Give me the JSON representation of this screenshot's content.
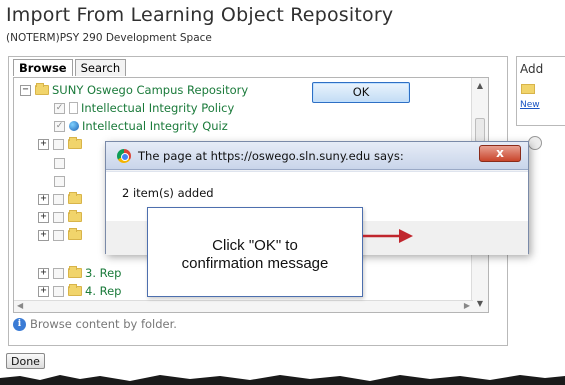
{
  "page": {
    "title": "Import From Learning Object Repository",
    "subtitle": "(NOTERM)PSY 290 Development Space"
  },
  "tabs": [
    {
      "label": "Browse",
      "active": true
    },
    {
      "label": "Search",
      "active": false
    }
  ],
  "tree": {
    "root": {
      "label": "SUNY Oswego Campus Repository",
      "expander": "−"
    },
    "items": [
      {
        "label": "Intellectual Integrity Policy",
        "icon": "document-icon",
        "checked": true
      },
      {
        "label": "Intellectual Integrity Quiz",
        "icon": "globe-icon",
        "checked": true
      }
    ],
    "folders": [
      {
        "label": "",
        "expander": "+"
      },
      {
        "label": "",
        "expander": ""
      },
      {
        "label": "",
        "expander": ""
      },
      {
        "label": "",
        "expander": "+"
      },
      {
        "label": "",
        "expander": "+"
      },
      {
        "label": "",
        "expander": "+"
      },
      {
        "label": "3. Rep",
        "expander": "+"
      },
      {
        "label": "4. Rep",
        "expander": "+"
      }
    ],
    "help_text": "Browse content by folder."
  },
  "side_panel": {
    "label": "Add",
    "link": "New"
  },
  "done_label": "Done",
  "dialog": {
    "title": "The page at https://oswego.sln.suny.edu says:",
    "close_label": "x",
    "message": "2 item(s) added",
    "ok_label": "OK"
  },
  "callout": {
    "line1": "Click \"OK\" to",
    "line2": "confirmation message"
  },
  "colors": {
    "tree_text": "#1a7a3a",
    "arrow": "#c0262d",
    "dialog_border": "#7a8aa8",
    "callout_border": "#4d6fae"
  }
}
